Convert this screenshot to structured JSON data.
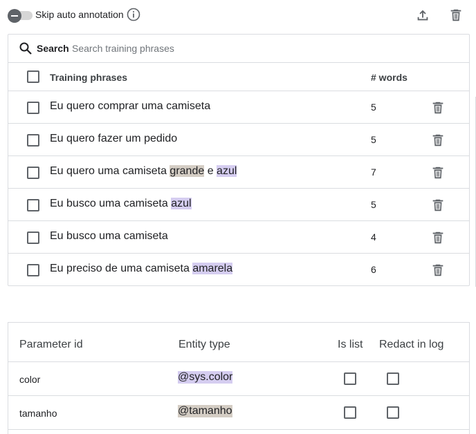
{
  "toolbar": {
    "toggle_label": "Skip auto annotation",
    "toggle_on": false,
    "icons": [
      "info-icon",
      "upload-icon",
      "delete-icon"
    ]
  },
  "search": {
    "label": "Search",
    "placeholder": "Search training phrases"
  },
  "phrases_table": {
    "col_phrase": "Training phrases",
    "col_words": "# words",
    "rows": [
      {
        "segments": [
          {
            "text": "Eu quero comprar uma camiseta",
            "hl": ""
          }
        ],
        "words": "5"
      },
      {
        "segments": [
          {
            "text": "Eu quero fazer um pedido",
            "hl": ""
          }
        ],
        "words": "5"
      },
      {
        "segments": [
          {
            "text": "Eu quero uma camiseta ",
            "hl": ""
          },
          {
            "text": "grande",
            "hl": "gray"
          },
          {
            "text": " e ",
            "hl": ""
          },
          {
            "text": "azul",
            "hl": "purple"
          }
        ],
        "words": "7"
      },
      {
        "segments": [
          {
            "text": "Eu busco uma camiseta ",
            "hl": ""
          },
          {
            "text": "azul",
            "hl": "purple"
          }
        ],
        "words": "5"
      },
      {
        "segments": [
          {
            "text": "Eu busco uma camiseta",
            "hl": ""
          }
        ],
        "words": "4"
      },
      {
        "segments": [
          {
            "text": "Eu preciso de uma camiseta ",
            "hl": ""
          },
          {
            "text": "amarela",
            "hl": "purple"
          }
        ],
        "words": "6"
      }
    ]
  },
  "parameters_table": {
    "col_id": "Parameter id",
    "col_entity": "Entity type",
    "col_list": "Is list",
    "col_redact": "Redact in log",
    "rows": [
      {
        "id": "color",
        "entity": "@sys.color",
        "entity_hl": "purple",
        "is_list": false,
        "redact": false
      },
      {
        "id": "tamanho",
        "entity": "@tamanho",
        "entity_hl": "gray",
        "is_list": false,
        "redact": false
      }
    ]
  },
  "colors": {
    "highlight_gray": "#d4cdc4",
    "highlight_purple": "#d5cdf0",
    "icon": "#5f6368",
    "border": "#dadce0"
  }
}
